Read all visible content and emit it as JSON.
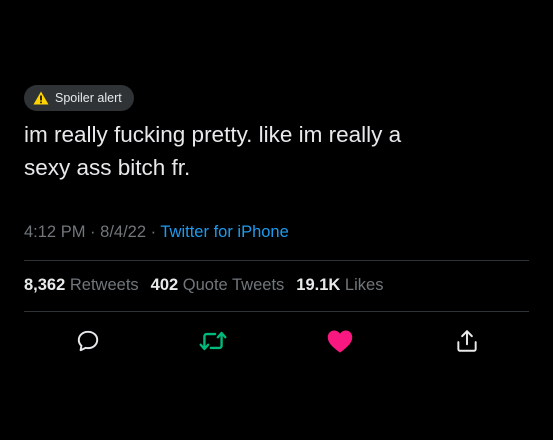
{
  "tweet": {
    "spoiler_label": "Spoiler alert",
    "text_line1": "im really fucking pretty. like im really a",
    "text_line2": "sexy ass bitch fr.",
    "time": "4:12 PM",
    "date": "8/4/22",
    "separator": "·",
    "source": "Twitter for iPhone"
  },
  "stats": {
    "retweets_count": "8,362",
    "retweets_label": "Retweets",
    "quote_count": "402",
    "quote_label": "Quote Tweets",
    "likes_count": "19.1K",
    "likes_label": "Likes"
  },
  "actions": {
    "reply_icon": "reply-icon",
    "retweet_icon": "retweet-icon",
    "like_icon": "heart-icon",
    "share_icon": "share-icon"
  },
  "colors": {
    "background": "#000000",
    "text": "#e7e9ea",
    "muted": "#71767b",
    "link": "#1d9bf0",
    "retweet_active": "#00ba7c",
    "like_active": "#f91880",
    "warning": "#ffd400"
  }
}
